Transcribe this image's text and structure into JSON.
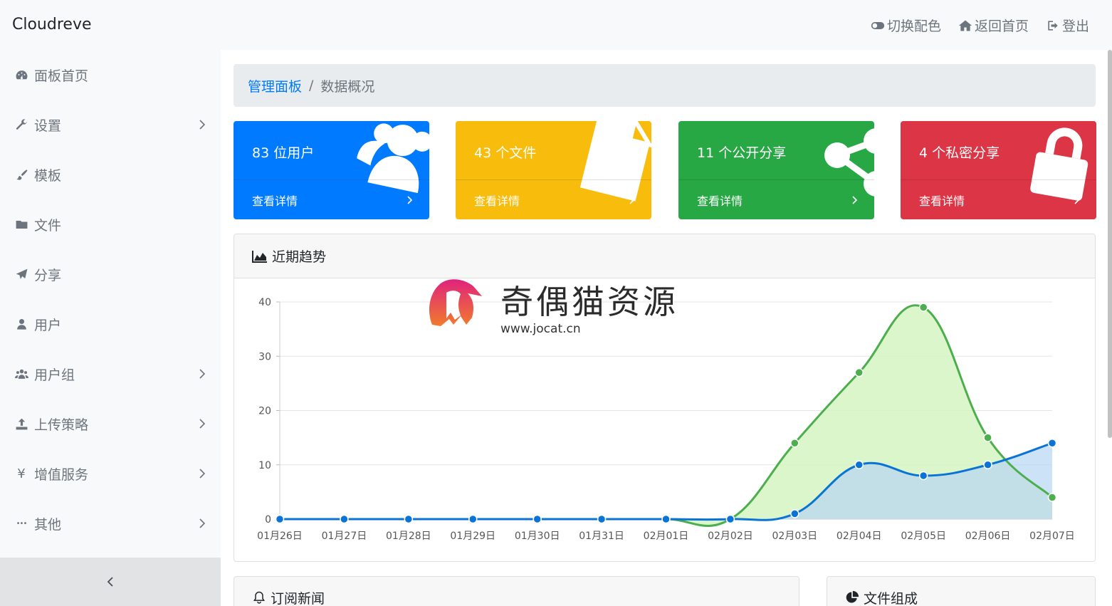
{
  "app": {
    "title": "Cloudreve"
  },
  "nav": {
    "theme": "切换配色",
    "home": "返回首页",
    "logout": "登出"
  },
  "sidebar": {
    "items": [
      {
        "label": "面板首页",
        "icon": "dashboard-icon",
        "has_submenu": false
      },
      {
        "label": "设置",
        "icon": "wrench-icon",
        "has_submenu": true
      },
      {
        "label": "模板",
        "icon": "brush-icon",
        "has_submenu": false
      },
      {
        "label": "文件",
        "icon": "folder-icon",
        "has_submenu": false
      },
      {
        "label": "分享",
        "icon": "paper-plane-icon",
        "has_submenu": false
      },
      {
        "label": "用户",
        "icon": "user-icon",
        "has_submenu": false
      },
      {
        "label": "用户组",
        "icon": "users-icon",
        "has_submenu": true
      },
      {
        "label": "上传策略",
        "icon": "upload-icon",
        "has_submenu": true
      },
      {
        "label": "增值服务",
        "icon": "yen-icon",
        "has_submenu": true
      },
      {
        "label": "其他",
        "icon": "ellipsis-icon",
        "has_submenu": true
      }
    ],
    "yen_glyph": "¥",
    "dots_glyph": "•••"
  },
  "breadcrumb": {
    "root": "管理面板",
    "separator": "/",
    "current": "数据概况"
  },
  "cards": [
    {
      "title": "83 位用户",
      "footer": "查看详情",
      "color": "#007bff",
      "icon": "users-icon"
    },
    {
      "title": "43 个文件",
      "footer": "查看详情",
      "color": "#ffc107",
      "icon": "file-icon"
    },
    {
      "title": "11 个公开分享",
      "footer": "查看详情",
      "color": "#28a745",
      "icon": "share-icon"
    },
    {
      "title": "4 个私密分享",
      "footer": "查看详情",
      "color": "#dc3545",
      "icon": "lock-icon"
    }
  ],
  "trend_panel": {
    "title": "近期趋势"
  },
  "chart_data": {
    "type": "area",
    "categories": [
      "01月26日",
      "01月27日",
      "01月28日",
      "01月29日",
      "01月30日",
      "01月31日",
      "02月01日",
      "02月02日",
      "02月03日",
      "02月04日",
      "02月05日",
      "02月06日",
      "02月07日"
    ],
    "series": [
      {
        "values": [
          0,
          0,
          0,
          0,
          0,
          0,
          0,
          0,
          14,
          27,
          39,
          15,
          4
        ],
        "color": "#4cae4c",
        "fill": "#d6f5c3"
      },
      {
        "values": [
          0,
          0,
          0,
          0,
          0,
          0,
          0,
          0,
          1,
          10,
          8,
          10,
          14
        ],
        "color": "#0a74d6",
        "fill": "#b6d6f2"
      }
    ],
    "yticks": [
      0,
      10,
      20,
      30,
      40
    ],
    "ylim": [
      0,
      40
    ],
    "grid": true
  },
  "watermark": {
    "text": "奇偶猫资源",
    "url": "www.jocat.cn"
  },
  "bottom_panels": [
    {
      "title": "订阅新闻",
      "icon": "bell-icon"
    },
    {
      "title": "文件组成",
      "icon": "pie-chart-icon"
    }
  ]
}
